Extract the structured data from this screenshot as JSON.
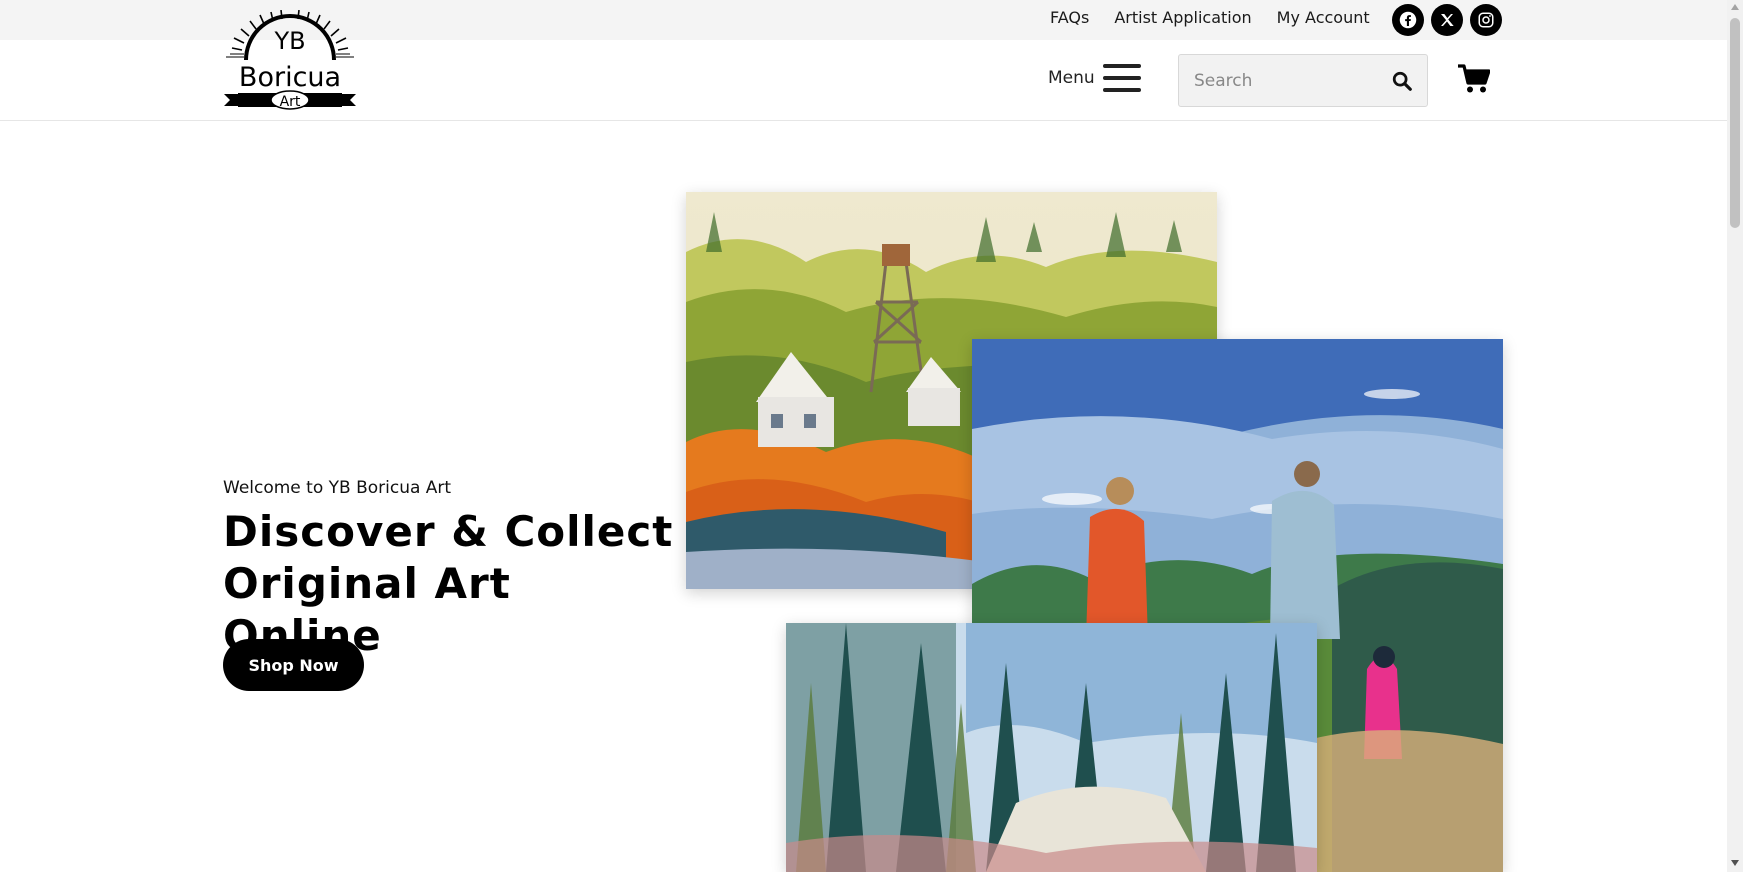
{
  "brand": {
    "logo_top": "YB",
    "logo_main": "Boricua",
    "logo_sub": "Art"
  },
  "topbar": {
    "links": [
      "FAQs",
      "Artist Application",
      "My Account"
    ],
    "socials": [
      "facebook-icon",
      "x-icon",
      "instagram-icon"
    ]
  },
  "header": {
    "menu_label": "Menu",
    "search_placeholder": "Search"
  },
  "hero": {
    "welcome": "Welcome to YB Boricua Art",
    "headline_line1": "Discover & Collect",
    "headline_line2": "Original Art Online",
    "cta_label": "Shop Now"
  },
  "colors": {
    "accent": "#000000",
    "topbar_bg": "#f4f4f4"
  }
}
